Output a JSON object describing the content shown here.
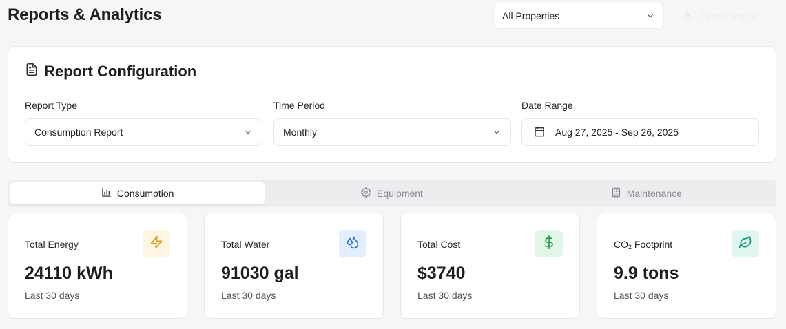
{
  "page": {
    "title": "Reports & Analytics"
  },
  "header": {
    "property_select": {
      "value": "All Properties"
    },
    "export_label": "Export Report"
  },
  "config": {
    "title": "Report Configuration",
    "report_type": {
      "label": "Report Type",
      "value": "Consumption Report"
    },
    "time_period": {
      "label": "Time Period",
      "value": "Monthly"
    },
    "date_range": {
      "label": "Date Range",
      "value": "Aug 27, 2025 - Sep 26, 2025"
    }
  },
  "tabs": [
    {
      "label": "Consumption",
      "icon": "bar-chart-icon",
      "active": true
    },
    {
      "label": "Equipment",
      "icon": "gear-icon",
      "active": false
    },
    {
      "label": "Maintenance",
      "icon": "building-icon",
      "active": false
    }
  ],
  "stats": [
    {
      "label": "Total Energy",
      "value": "24110 kWh",
      "sub": "Last 30 days",
      "icon": "lightning-icon",
      "badge_bg": "#fef6e0",
      "icon_color": "#d99a1e"
    },
    {
      "label": "Total Water",
      "value": "91030 gal",
      "sub": "Last 30 days",
      "icon": "droplets-icon",
      "badge_bg": "#e3efff",
      "icon_color": "#2f6fd6"
    },
    {
      "label": "Total Cost",
      "value": "$3740",
      "sub": "Last 30 days",
      "icon": "dollar-icon",
      "badge_bg": "#e2f6e8",
      "icon_color": "#1f9a4a"
    },
    {
      "label_prefix": "CO",
      "label_sub": "2",
      "label_suffix": " Footprint",
      "value": "9.9 tons",
      "sub": "Last 30 days",
      "icon": "leaf-icon",
      "badge_bg": "#e0f7f1",
      "icon_color": "#15967a"
    }
  ]
}
